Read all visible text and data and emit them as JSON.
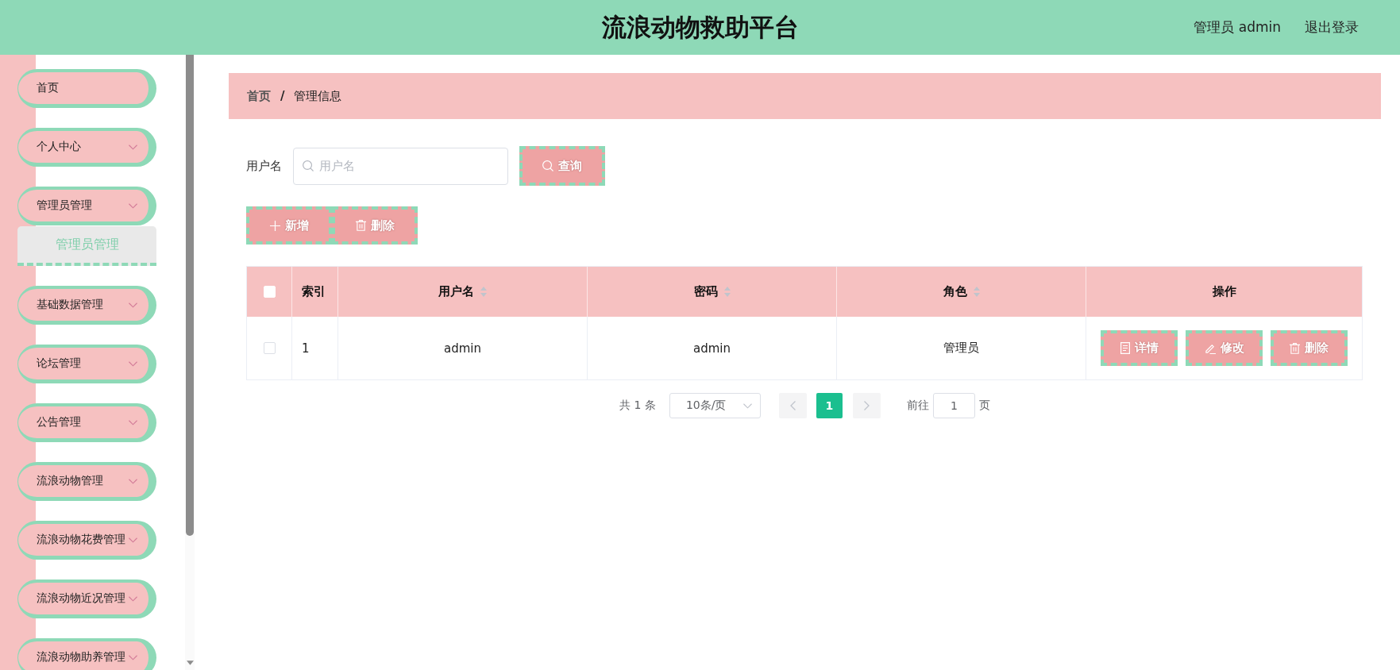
{
  "header": {
    "title": "流浪动物救助平台",
    "user": "管理员 admin",
    "logout": "退出登录"
  },
  "sidebar": {
    "items": [
      {
        "kind": "link",
        "label": "首页"
      },
      {
        "kind": "submenu",
        "label": "个人中心"
      },
      {
        "kind": "submenu",
        "label": "管理员管理",
        "children": [
          {
            "label": "管理员管理",
            "selected": true
          }
        ]
      },
      {
        "kind": "submenu",
        "label": "基础数据管理"
      },
      {
        "kind": "submenu",
        "label": "论坛管理"
      },
      {
        "kind": "submenu",
        "label": "公告管理"
      },
      {
        "kind": "submenu",
        "label": "流浪动物管理"
      },
      {
        "kind": "submenu",
        "label": "流浪动物花费管理"
      },
      {
        "kind": "submenu",
        "label": "流浪动物近况管理"
      },
      {
        "kind": "submenu",
        "label": "流浪动物助养管理"
      }
    ]
  },
  "breadcrumb": {
    "items": [
      {
        "label": "首页"
      },
      {
        "label": "管理信息"
      }
    ],
    "separator": "/"
  },
  "search": {
    "label": "用户名",
    "placeholder": "用户名",
    "button": "查询"
  },
  "toolbar": [
    {
      "kind": "add",
      "label": "新增"
    },
    {
      "kind": "delete",
      "label": "删除"
    }
  ],
  "table": {
    "select_all": {
      "checked": false
    },
    "columns": [
      {
        "kind": "index",
        "label": "索引",
        "sortable": false
      },
      {
        "kind": "text",
        "label": "用户名",
        "sortable": true
      },
      {
        "kind": "text",
        "label": "密码",
        "sortable": true
      },
      {
        "kind": "text",
        "label": "角色",
        "sortable": true
      },
      {
        "kind": "actions",
        "label": "操作",
        "sortable": false
      }
    ],
    "rows": [
      {
        "checked": false,
        "cells": [
          "1",
          "admin",
          "admin",
          "管理员"
        ],
        "actions": [
          {
            "kind": "detail",
            "label": "详情"
          },
          {
            "kind": "edit",
            "label": "修改"
          },
          {
            "kind": "delete",
            "label": "删除"
          }
        ]
      }
    ]
  },
  "pagination": {
    "total": "共 1 条",
    "page_size": "10条/页",
    "prev": {
      "disabled": true
    },
    "pages": [
      {
        "label": "1",
        "selected": true
      }
    ],
    "next": {
      "disabled": true
    },
    "goto_label": "前往",
    "goto_value": "1",
    "goto_suffix": "页"
  }
}
